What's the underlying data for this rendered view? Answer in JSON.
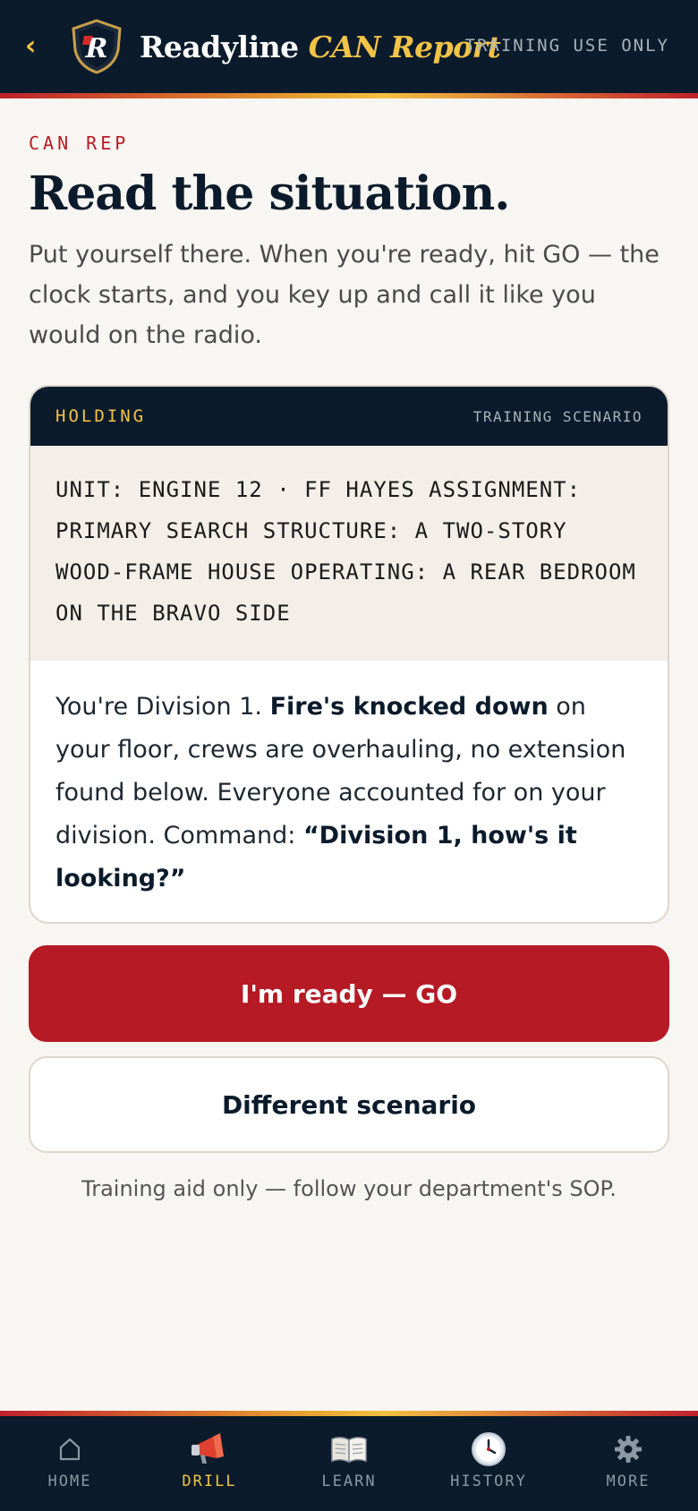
{
  "header": {
    "back_icon": "chevron-left-icon",
    "back_glyph": "‹",
    "logo_icon": "shield-r-logo",
    "logo_letter": "R",
    "brand_primary": "Readyline",
    "brand_accent": "CAN Report",
    "tag": "TRAINING USE ONLY"
  },
  "intro": {
    "eyebrow": "CAN REP",
    "title": "Read the situation.",
    "body": "Put yourself there. When you're ready, hit GO — the clock starts, and you key up and call it like you would on the radio."
  },
  "scenario": {
    "status": "HOLDING",
    "kind": "TRAINING SCENARIO",
    "meta": "UNIT: ENGINE 12 · FF HAYES ASSIGNMENT: PRIMARY SEARCH STRUCTURE: A TWO-STORY WOOD-FRAME HOUSE OPERATING: A REAR BEDROOM ON THE BRAVO SIDE",
    "body_1": "You're Division 1. ",
    "body_2": "Fire's knocked down",
    "body_3": " on your floor, crews are overhauling, no extension found below. Everyone accounted for on your division. Command: ",
    "body_4": "“Division 1, how's it looking?”"
  },
  "actions": {
    "go_label": "I'm ready — GO",
    "alt_label": "Different scenario"
  },
  "disclaimer": "Training aid only — follow your department's SOP.",
  "nav": {
    "items": [
      {
        "label": "HOME",
        "icon": "home-icon",
        "active": false
      },
      {
        "label": "DRILL",
        "icon": "megaphone-icon",
        "active": true
      },
      {
        "label": "LEARN",
        "icon": "open-book-icon",
        "active": false
      },
      {
        "label": "HISTORY",
        "icon": "clock-icon",
        "active": false
      },
      {
        "label": "MORE",
        "icon": "gear-icon",
        "active": false
      }
    ]
  },
  "colors": {
    "navy": "#0b1b2b",
    "gold": "#f2c347",
    "red": "#b51a25",
    "background": "#f8f6f2"
  }
}
